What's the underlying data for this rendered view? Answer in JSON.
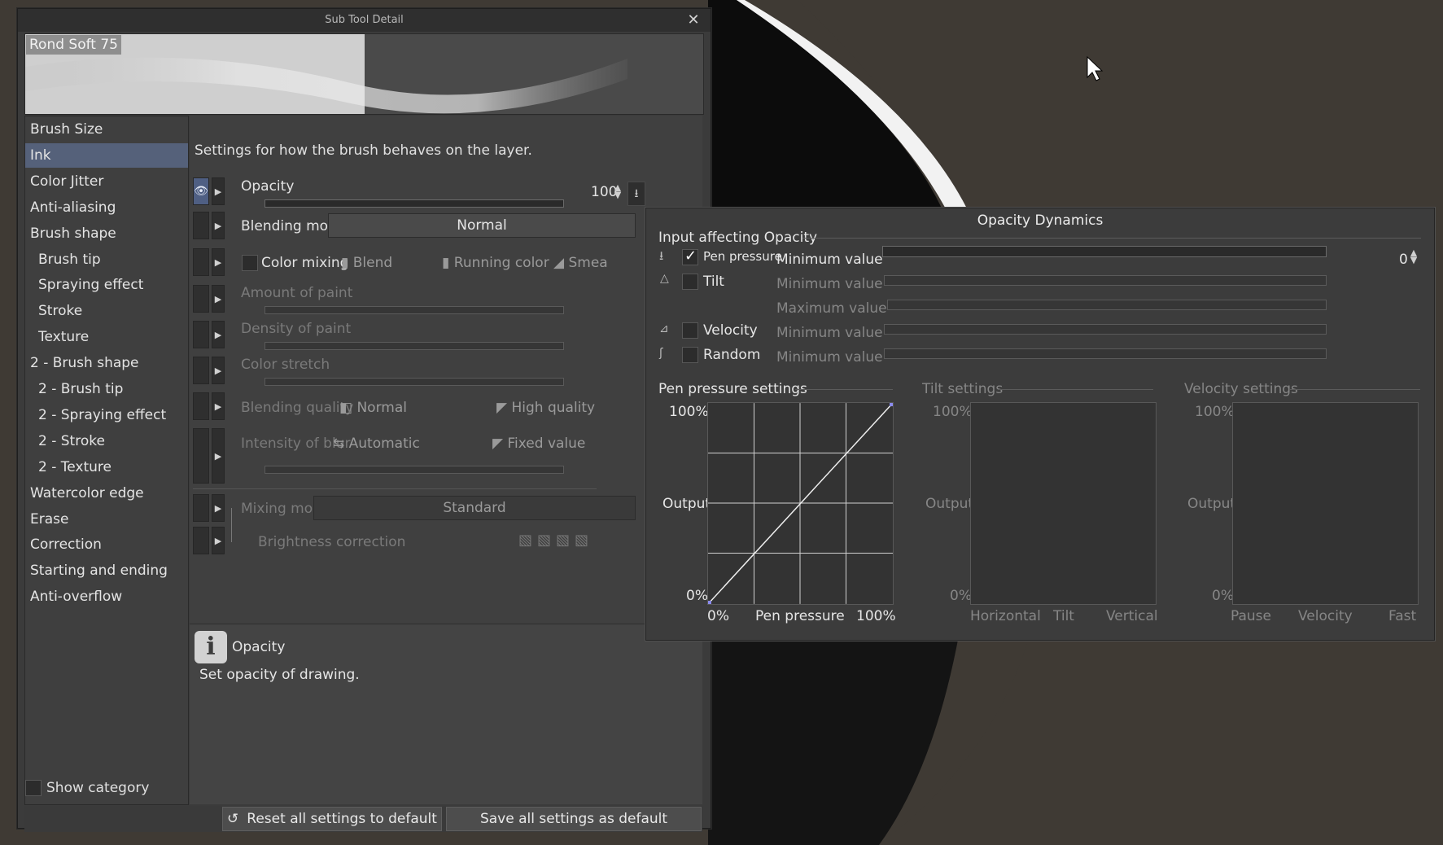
{
  "dialog": {
    "title": "Sub Tool Detail",
    "close_label": "✕",
    "brush_name": "Rond Soft 75",
    "description": "Settings for how the brush behaves on the layer.",
    "categories": [
      {
        "label": "Brush Size",
        "sub": false,
        "active": false
      },
      {
        "label": "Ink",
        "sub": false,
        "active": true
      },
      {
        "label": "Color Jitter",
        "sub": false,
        "active": false
      },
      {
        "label": "Anti-aliasing",
        "sub": false,
        "active": false
      },
      {
        "label": "Brush shape",
        "sub": false,
        "active": false
      },
      {
        "label": "Brush tip",
        "sub": true,
        "active": false
      },
      {
        "label": "Spraying effect",
        "sub": true,
        "active": false
      },
      {
        "label": "Stroke",
        "sub": true,
        "active": false
      },
      {
        "label": "Texture",
        "sub": true,
        "active": false
      },
      {
        "label": "2 - Brush shape",
        "sub": false,
        "active": false
      },
      {
        "label": "2 - Brush tip",
        "sub": true,
        "active": false
      },
      {
        "label": "2 - Spraying effect",
        "sub": true,
        "active": false
      },
      {
        "label": "2 - Stroke",
        "sub": true,
        "active": false
      },
      {
        "label": "2 - Texture",
        "sub": true,
        "active": false
      },
      {
        "label": "Watercolor edge",
        "sub": false,
        "active": false
      },
      {
        "label": "Erase",
        "sub": false,
        "active": false
      },
      {
        "label": "Correction",
        "sub": false,
        "active": false
      },
      {
        "label": "Starting and ending",
        "sub": false,
        "active": false
      },
      {
        "label": "Anti-overflow",
        "sub": false,
        "active": false
      }
    ],
    "show_category": "Show category",
    "settings": {
      "opacity_label": "Opacity",
      "opacity_value": "100",
      "opacity_fraction": 1.0,
      "blending_mode_label": "Blending mode",
      "blending_mode_value": "Normal",
      "color_mixing_label": "Color mixing",
      "blend_label": "Blend",
      "running_color_label": "Running color",
      "smear_label": "Smea",
      "amount_of_paint": "Amount of paint",
      "density_of_paint": "Density of paint",
      "color_stretch": "Color stretch",
      "blending_quality_label": "Blending quality",
      "blending_quality_normal": "Normal",
      "blending_quality_high": "High quality",
      "intensity_of_blur_label": "Intensity of blur",
      "blur_automatic": "Automatic",
      "blur_fixed": "Fixed value",
      "mixing_mode_label": "Mixing mode",
      "mixing_mode_value": "Standard",
      "brightness_correction": "Brightness correction"
    },
    "help": {
      "title": "Opacity",
      "text": "Set opacity of drawing."
    },
    "buttons": {
      "reset": "Reset all settings to default",
      "save": "Save all settings as default"
    }
  },
  "dynamics": {
    "title": "Opacity Dynamics",
    "input_header": "Input affecting Opacity",
    "inputs": [
      {
        "name": "Pen pressure",
        "checked": true,
        "sub_label": "Minimum value",
        "value": "0"
      },
      {
        "name": "Tilt",
        "checked": false,
        "sub_label": "Minimum value",
        "max_label": "Maximum value"
      },
      {
        "name": "Velocity",
        "checked": false,
        "sub_label": "Minimum value"
      },
      {
        "name": "Random",
        "checked": false,
        "sub_label": "Minimum value"
      }
    ],
    "graphs": [
      {
        "title": "Pen pressure settings",
        "y_top": "100%",
        "y_mid": "Output",
        "y_bottom": "0%",
        "x_left": "0%",
        "x_mid": "Pen pressure",
        "x_right": "100%",
        "enabled": true
      },
      {
        "title": "Tilt settings",
        "y_top": "100%",
        "y_mid": "Output",
        "y_bottom": "0%",
        "x_left": "Horizontal",
        "x_mid": "Tilt",
        "x_right": "Vertical",
        "enabled": false
      },
      {
        "title": "Velocity settings",
        "y_top": "100%",
        "y_mid": "Output",
        "y_bottom": "0%",
        "x_left": "Pause",
        "x_mid": "Velocity",
        "x_right": "Fast",
        "enabled": false
      }
    ],
    "pressure_curve": [
      [
        0,
        0
      ],
      [
        100,
        100
      ]
    ]
  },
  "colors": {
    "accent": "#55617a",
    "dialog_bg": "#3b3b3b",
    "canvas_bg": "#3f3a34"
  }
}
